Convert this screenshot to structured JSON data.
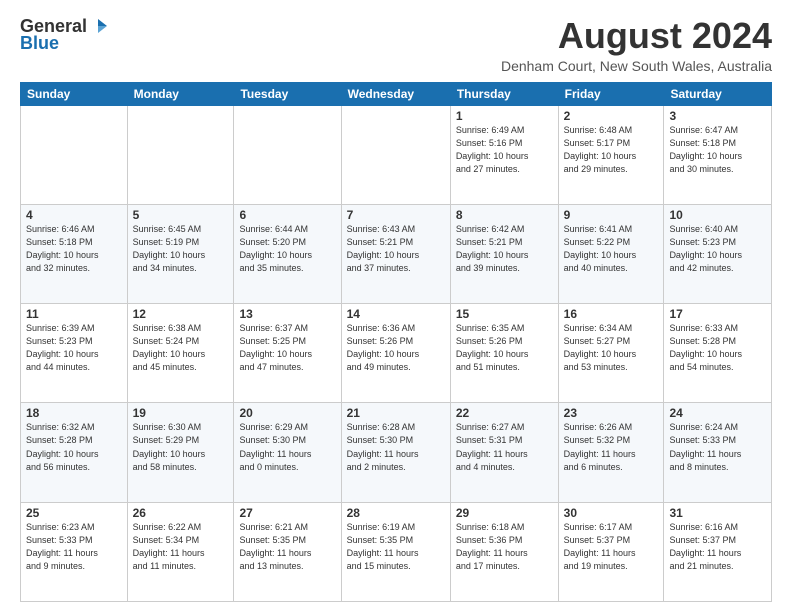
{
  "logo": {
    "general": "General",
    "blue": "Blue"
  },
  "header": {
    "month": "August 2024",
    "location": "Denham Court, New South Wales, Australia"
  },
  "weekdays": [
    "Sunday",
    "Monday",
    "Tuesday",
    "Wednesday",
    "Thursday",
    "Friday",
    "Saturday"
  ],
  "weeks": [
    [
      {
        "day": "",
        "info": ""
      },
      {
        "day": "",
        "info": ""
      },
      {
        "day": "",
        "info": ""
      },
      {
        "day": "",
        "info": ""
      },
      {
        "day": "1",
        "info": "Sunrise: 6:49 AM\nSunset: 5:16 PM\nDaylight: 10 hours\nand 27 minutes."
      },
      {
        "day": "2",
        "info": "Sunrise: 6:48 AM\nSunset: 5:17 PM\nDaylight: 10 hours\nand 29 minutes."
      },
      {
        "day": "3",
        "info": "Sunrise: 6:47 AM\nSunset: 5:18 PM\nDaylight: 10 hours\nand 30 minutes."
      }
    ],
    [
      {
        "day": "4",
        "info": "Sunrise: 6:46 AM\nSunset: 5:18 PM\nDaylight: 10 hours\nand 32 minutes."
      },
      {
        "day": "5",
        "info": "Sunrise: 6:45 AM\nSunset: 5:19 PM\nDaylight: 10 hours\nand 34 minutes."
      },
      {
        "day": "6",
        "info": "Sunrise: 6:44 AM\nSunset: 5:20 PM\nDaylight: 10 hours\nand 35 minutes."
      },
      {
        "day": "7",
        "info": "Sunrise: 6:43 AM\nSunset: 5:21 PM\nDaylight: 10 hours\nand 37 minutes."
      },
      {
        "day": "8",
        "info": "Sunrise: 6:42 AM\nSunset: 5:21 PM\nDaylight: 10 hours\nand 39 minutes."
      },
      {
        "day": "9",
        "info": "Sunrise: 6:41 AM\nSunset: 5:22 PM\nDaylight: 10 hours\nand 40 minutes."
      },
      {
        "day": "10",
        "info": "Sunrise: 6:40 AM\nSunset: 5:23 PM\nDaylight: 10 hours\nand 42 minutes."
      }
    ],
    [
      {
        "day": "11",
        "info": "Sunrise: 6:39 AM\nSunset: 5:23 PM\nDaylight: 10 hours\nand 44 minutes."
      },
      {
        "day": "12",
        "info": "Sunrise: 6:38 AM\nSunset: 5:24 PM\nDaylight: 10 hours\nand 45 minutes."
      },
      {
        "day": "13",
        "info": "Sunrise: 6:37 AM\nSunset: 5:25 PM\nDaylight: 10 hours\nand 47 minutes."
      },
      {
        "day": "14",
        "info": "Sunrise: 6:36 AM\nSunset: 5:26 PM\nDaylight: 10 hours\nand 49 minutes."
      },
      {
        "day": "15",
        "info": "Sunrise: 6:35 AM\nSunset: 5:26 PM\nDaylight: 10 hours\nand 51 minutes."
      },
      {
        "day": "16",
        "info": "Sunrise: 6:34 AM\nSunset: 5:27 PM\nDaylight: 10 hours\nand 53 minutes."
      },
      {
        "day": "17",
        "info": "Sunrise: 6:33 AM\nSunset: 5:28 PM\nDaylight: 10 hours\nand 54 minutes."
      }
    ],
    [
      {
        "day": "18",
        "info": "Sunrise: 6:32 AM\nSunset: 5:28 PM\nDaylight: 10 hours\nand 56 minutes."
      },
      {
        "day": "19",
        "info": "Sunrise: 6:30 AM\nSunset: 5:29 PM\nDaylight: 10 hours\nand 58 minutes."
      },
      {
        "day": "20",
        "info": "Sunrise: 6:29 AM\nSunset: 5:30 PM\nDaylight: 11 hours\nand 0 minutes."
      },
      {
        "day": "21",
        "info": "Sunrise: 6:28 AM\nSunset: 5:30 PM\nDaylight: 11 hours\nand 2 minutes."
      },
      {
        "day": "22",
        "info": "Sunrise: 6:27 AM\nSunset: 5:31 PM\nDaylight: 11 hours\nand 4 minutes."
      },
      {
        "day": "23",
        "info": "Sunrise: 6:26 AM\nSunset: 5:32 PM\nDaylight: 11 hours\nand 6 minutes."
      },
      {
        "day": "24",
        "info": "Sunrise: 6:24 AM\nSunset: 5:33 PM\nDaylight: 11 hours\nand 8 minutes."
      }
    ],
    [
      {
        "day": "25",
        "info": "Sunrise: 6:23 AM\nSunset: 5:33 PM\nDaylight: 11 hours\nand 9 minutes."
      },
      {
        "day": "26",
        "info": "Sunrise: 6:22 AM\nSunset: 5:34 PM\nDaylight: 11 hours\nand 11 minutes."
      },
      {
        "day": "27",
        "info": "Sunrise: 6:21 AM\nSunset: 5:35 PM\nDaylight: 11 hours\nand 13 minutes."
      },
      {
        "day": "28",
        "info": "Sunrise: 6:19 AM\nSunset: 5:35 PM\nDaylight: 11 hours\nand 15 minutes."
      },
      {
        "day": "29",
        "info": "Sunrise: 6:18 AM\nSunset: 5:36 PM\nDaylight: 11 hours\nand 17 minutes."
      },
      {
        "day": "30",
        "info": "Sunrise: 6:17 AM\nSunset: 5:37 PM\nDaylight: 11 hours\nand 19 minutes."
      },
      {
        "day": "31",
        "info": "Sunrise: 6:16 AM\nSunset: 5:37 PM\nDaylight: 11 hours\nand 21 minutes."
      }
    ]
  ]
}
